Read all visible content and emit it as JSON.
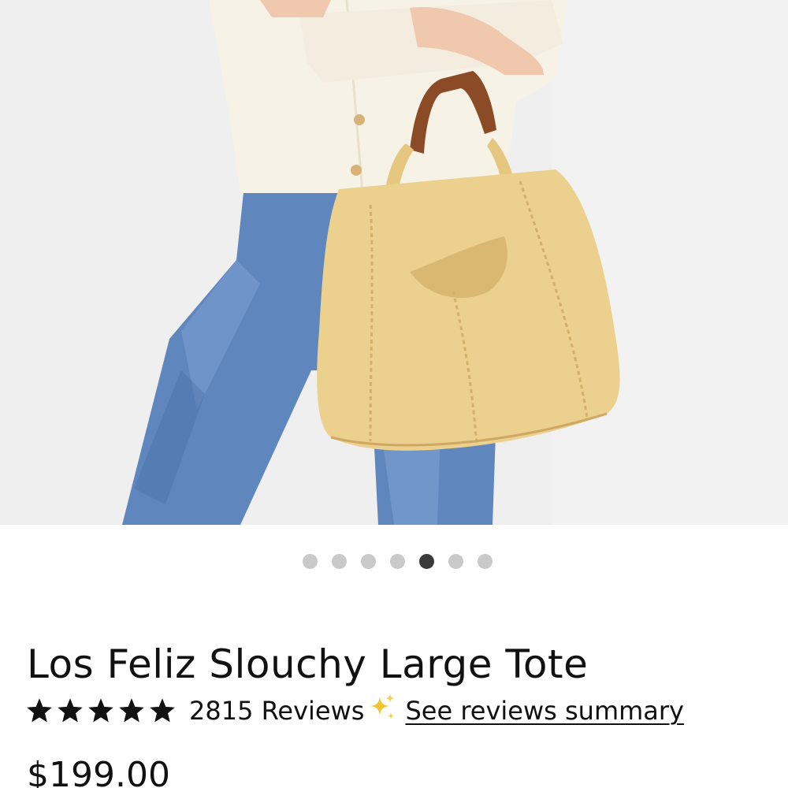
{
  "product": {
    "title": "Los Feliz Slouchy Large Tote",
    "rating_value": 5,
    "reviews_label": "2815 Reviews",
    "summary_link": "See reviews summary",
    "price": "$199.00",
    "image_alt": "Model holding a butter-yellow slouchy leather tote with brown handle"
  },
  "carousel": {
    "dot_count": 7,
    "active_index": 4
  },
  "colors": {
    "star": "#111111",
    "sparkle": "#f2c431",
    "active_dot": "#3a3a3a",
    "inactive_dot": "#c9c9c9",
    "bag": "#ecd08e",
    "handle": "#8a4b26",
    "denim": "#5f86bd",
    "sweater": "#f7f2e6"
  },
  "icons": {
    "star": "star-icon",
    "sparkle": "sparkle-icon"
  }
}
